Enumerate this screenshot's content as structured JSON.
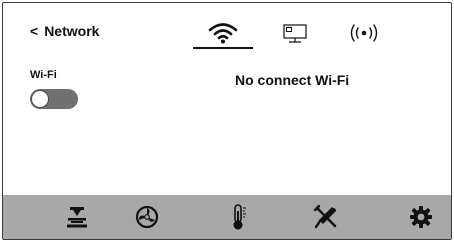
{
  "header": {
    "back_chevron": "<",
    "back_label": "Network"
  },
  "tabs": [
    {
      "id": "wifi",
      "icon": "wifi-icon",
      "active": true
    },
    {
      "id": "ethernet",
      "icon": "ethernet-monitor-icon",
      "active": false
    },
    {
      "id": "hotspot",
      "icon": "hotspot-broadcast-icon",
      "active": false
    }
  ],
  "wifi_section": {
    "label": "Wi-Fi",
    "toggle_on": false
  },
  "status": {
    "message": "No connect Wi-Fi"
  },
  "bottom_nav": [
    {
      "id": "print",
      "icon": "print-head-icon"
    },
    {
      "id": "fan",
      "icon": "fan-icon"
    },
    {
      "id": "temperature",
      "icon": "thermometer-icon"
    },
    {
      "id": "tools",
      "icon": "tools-icon"
    },
    {
      "id": "settings",
      "icon": "gear-icon"
    }
  ],
  "colors": {
    "bottom_bar": "#a8a8a8",
    "toggle_off": "#707070",
    "text": "#111111"
  }
}
